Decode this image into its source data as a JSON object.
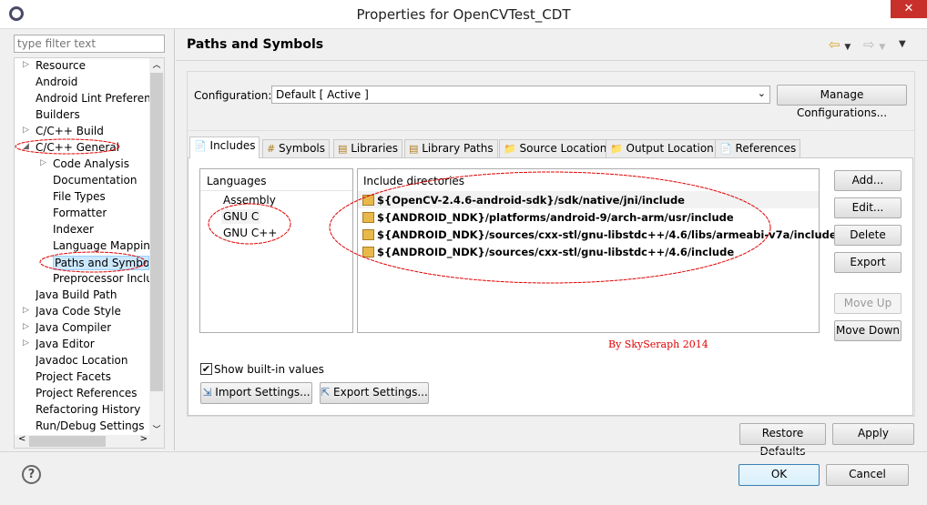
{
  "window": {
    "title": "Properties for OpenCVTest_CDT",
    "close": "✕"
  },
  "sidebar": {
    "filter_placeholder": "type filter text",
    "items": [
      {
        "label": "Resource",
        "expander": "▷"
      },
      {
        "label": "Android"
      },
      {
        "label": "Android Lint Preference"
      },
      {
        "label": "Builders"
      },
      {
        "label": "C/C++ Build",
        "expander": "▷"
      },
      {
        "label": "C/C++ General",
        "expander": "◢"
      },
      {
        "label": "Code Analysis",
        "expander": "▷",
        "child": true
      },
      {
        "label": "Documentation",
        "child": true
      },
      {
        "label": "File Types",
        "child": true
      },
      {
        "label": "Formatter",
        "child": true
      },
      {
        "label": "Indexer",
        "child": true
      },
      {
        "label": "Language Mappings",
        "child": true
      },
      {
        "label": "Paths and Symbols",
        "child": true,
        "selected": true
      },
      {
        "label": "Preprocessor Include",
        "child": true
      },
      {
        "label": "Java Build Path"
      },
      {
        "label": "Java Code Style",
        "expander": "▷"
      },
      {
        "label": "Java Compiler",
        "expander": "▷"
      },
      {
        "label": "Java Editor",
        "expander": "▷"
      },
      {
        "label": "Javadoc Location"
      },
      {
        "label": "Project Facets"
      },
      {
        "label": "Project References"
      },
      {
        "label": "Refactoring History"
      },
      {
        "label": "Run/Debug Settings"
      }
    ]
  },
  "page": {
    "title": "Paths and Symbols",
    "config_label": "Configuration:",
    "config_value": "Default  [ Active ]",
    "manage_button": "Manage Configurations...",
    "tabs": [
      "Includes",
      "Symbols",
      "Libraries",
      "Library Paths",
      "Source Location",
      "Output Location",
      "References"
    ],
    "languages_header": "Languages",
    "languages": [
      "Assembly",
      "GNU C",
      "GNU C++"
    ],
    "includes_header": "Include directories",
    "includes": [
      "${OpenCV-2.4.6-android-sdk}/sdk/native/jni/include",
      "${ANDROID_NDK}/platforms/android-9/arch-arm/usr/include",
      "${ANDROID_NDK}/sources/cxx-stl/gnu-libstdc++/4.6/libs/armeabi-v7a/include",
      "${ANDROID_NDK}/sources/cxx-stl/gnu-libstdc++/4.6/include"
    ],
    "side_buttons": {
      "add": "Add...",
      "edit": "Edit...",
      "delete": "Delete",
      "export": "Export",
      "move_up": "Move Up",
      "move_down": "Move Down"
    },
    "watermark": "By SkySeraph 2014",
    "show_builtin": "Show built-in values",
    "show_builtin_checked": true,
    "import_settings": "Import Settings...",
    "export_settings": "Export Settings...",
    "restore_defaults": "Restore Defaults",
    "apply": "Apply"
  },
  "footer": {
    "help": "?",
    "ok": "OK",
    "cancel": "Cancel"
  },
  "colors": {
    "annotation": "#e00000",
    "selection": "#cce8ff"
  }
}
